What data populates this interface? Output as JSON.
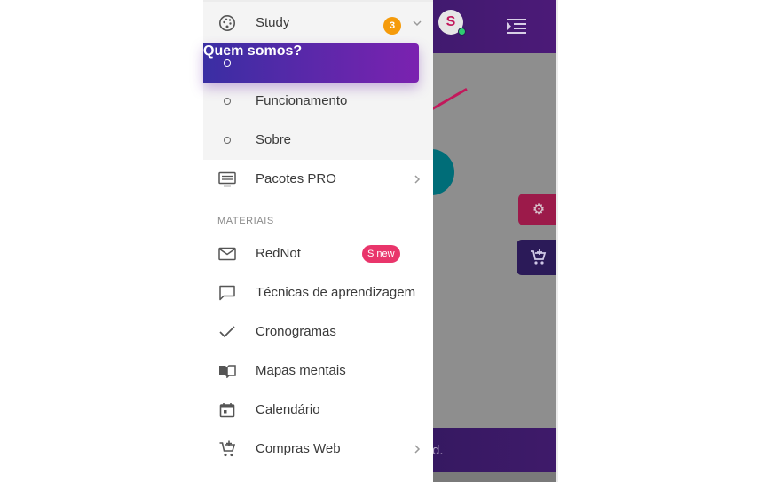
{
  "drawer": {
    "study": {
      "label": "Study",
      "badge": "3"
    },
    "sub_items": [
      {
        "label": "Quem somos?"
      },
      {
        "label": "Funcionamento"
      },
      {
        "label": "Sobre"
      }
    ],
    "pacotes": {
      "label": "Pacotes PRO"
    },
    "section_title": "MATERIAIS",
    "materials": [
      {
        "label": "RedNot",
        "badge": "S new"
      },
      {
        "label": "Técnicas de aprendizagem"
      },
      {
        "label": "Cronogramas"
      },
      {
        "label": "Mapas mentais"
      },
      {
        "label": "Calendário"
      },
      {
        "label": "Compras Web"
      }
    ]
  },
  "background": {
    "logo_letter": "S",
    "footer_text": "d."
  },
  "colors": {
    "active_gradient_start": "#3a2ea3",
    "active_gradient_end": "#7b22b0",
    "badge_orange": "#f59b0b",
    "badge_pink": "#e9356b"
  }
}
